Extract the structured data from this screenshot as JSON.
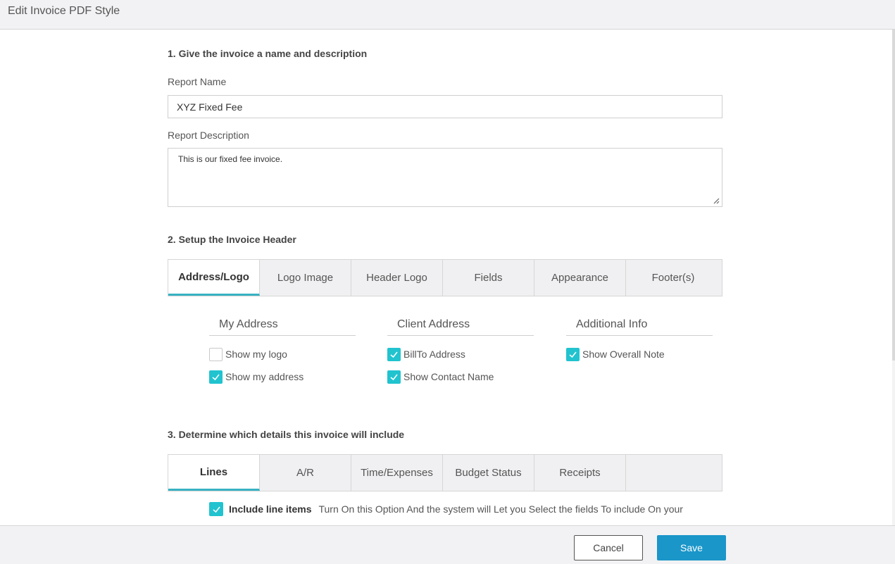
{
  "window": {
    "title": "Edit Invoice PDF Style"
  },
  "section1": {
    "title": "1. Give the invoice a name and description",
    "report_name_label": "Report Name",
    "report_name_value": "XYZ Fixed Fee",
    "report_description_label": "Report Description",
    "report_description_value": "This is our fixed fee invoice."
  },
  "section2": {
    "title": "2. Setup the Invoice Header",
    "tabs": [
      "Address/Logo",
      "Logo Image",
      "Header Logo",
      "Fields",
      "Appearance",
      "Footer(s)"
    ],
    "active_tab": "Address/Logo",
    "columns": [
      {
        "heading": "My Address",
        "options": [
          {
            "label": "Show my logo",
            "checked": false
          },
          {
            "label": "Show my address",
            "checked": true
          }
        ]
      },
      {
        "heading": "Client Address",
        "options": [
          {
            "label": "BillTo Address",
            "checked": true
          },
          {
            "label": "Show Contact Name",
            "checked": true
          }
        ]
      },
      {
        "heading": "Additional Info",
        "options": [
          {
            "label": "Show Overall Note",
            "checked": true
          }
        ]
      }
    ]
  },
  "section3": {
    "title": "3. Determine which details this invoice will include",
    "tabs": [
      "Lines",
      "A/R",
      "Time/Expenses",
      "Budget Status",
      "Receipts"
    ],
    "active_tab": "Lines",
    "include_line_items": {
      "label": "Include line items",
      "description": "Turn On this Option And the system will Let you Select the fields To include On your",
      "checked": true
    }
  },
  "footer": {
    "cancel_label": "Cancel",
    "save_label": "Save"
  },
  "colors": {
    "accent": "#21c3cf",
    "primary_button": "#1a96c9",
    "tab_underline": "#38b2c2"
  }
}
